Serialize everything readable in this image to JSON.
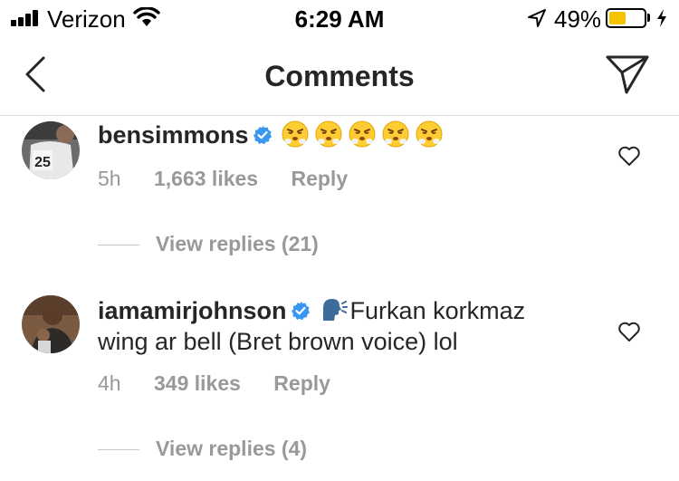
{
  "status_bar": {
    "carrier": "Verizon",
    "time": "6:29 AM",
    "battery_percent": "49%",
    "battery_level": 0.49,
    "battery_color": "#f5c400"
  },
  "header": {
    "title": "Comments",
    "back_icon": "chevron-left-icon",
    "send_icon": "paper-plane-icon"
  },
  "comments": [
    {
      "username": "bensimmons",
      "verified": true,
      "text": "",
      "emojis": [
        "steam-face-emoji",
        "steam-face-emoji",
        "steam-face-emoji",
        "steam-face-emoji",
        "steam-face-emoji"
      ],
      "time": "5h",
      "likes": "1,663 likes",
      "reply_label": "Reply",
      "view_replies": "View replies (21)"
    },
    {
      "username": "iamamirjohnson",
      "verified": true,
      "text_line1": "Furkan korkmaz",
      "text_line2": "wing ar bell (Bret brown voice) lol",
      "emoji": "speaking-head-emoji",
      "time": "4h",
      "likes": "349 likes",
      "reply_label": "Reply",
      "view_replies": "View replies (4)"
    }
  ],
  "colors": {
    "text": "#262626",
    "secondary": "#999999",
    "verified": "#3897f0",
    "divider": "#dbdbdb"
  }
}
